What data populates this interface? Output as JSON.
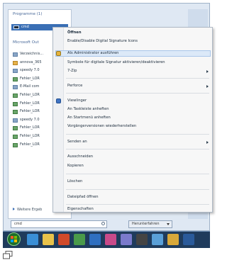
{
  "start_menu": {
    "programs_header": "Programme (1)",
    "selected_program": "cmd",
    "documents_header": "Microsoft Out",
    "recent_items": [
      "Verzeichnis...",
      "annova_365",
      "speedy 7.0",
      "Fehler_LOR",
      "E-Mail com",
      "Fehler_LOR",
      "Fehler_LOR",
      "Fehler_LOR",
      "speedy 7.0",
      "Fehler_LOR",
      "Fehler_LOR",
      "Fehler_LOR"
    ],
    "all_programs_label": "Weitere Ergeb",
    "search_value": "cmd",
    "shutdown_label": "Herunterfahren"
  },
  "context_menu": {
    "items": [
      {
        "label": "Öffnen",
        "bold": true
      },
      {
        "label": "Enable/Disable Digital Signature Icons"
      },
      {
        "label": "Als Administrator ausführen",
        "highlighted": true,
        "icon": "shield-icon"
      },
      {
        "label": "Symbole für digitale Signatur aktivieren/deaktivieren"
      },
      {
        "label": "7-Zip",
        "submenu": true
      },
      {
        "label": "Perforce",
        "submenu": true
      },
      {
        "label": "Viewlinger",
        "icon": "app-icon"
      },
      {
        "label": "An Taskleiste anheften"
      },
      {
        "label": "An Startmenü anheften"
      },
      {
        "label": "Vorgängerversionen wiederherstellen"
      },
      {
        "label": "Senden an",
        "submenu": true
      },
      {
        "label": "Ausschneiden"
      },
      {
        "label": "Kopieren"
      },
      {
        "label": "Löschen"
      },
      {
        "label": "Dateipfad öffnen"
      },
      {
        "label": "Eigenschaften"
      }
    ]
  },
  "colors": {
    "selection": "#3a6fb5",
    "menu_highlight": "#dce9f8",
    "taskbar": "#1f3b5c"
  }
}
